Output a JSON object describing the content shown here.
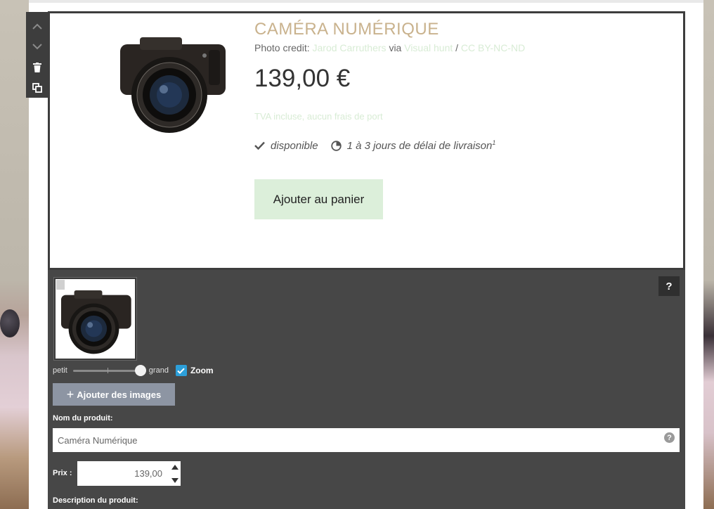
{
  "product": {
    "title": "CAMÉRA NUMÉRIQUE",
    "credit_prefix": "Photo credit:",
    "credit_author": "Jarod Carruthers",
    "credit_via": "via",
    "credit_source": "Visual hunt",
    "credit_sep": "/",
    "credit_license": "CC BY-NC-ND",
    "price": "139,00 €",
    "tax_note": "TVA incluse, aucun frais de port",
    "availability": "disponible",
    "delivery": "1 à 3 jours de délai de livraison",
    "delivery_footnote": "1",
    "add_to_cart": "Ajouter au panier"
  },
  "editor": {
    "help_label": "?",
    "size_small": "petit",
    "size_large": "grand",
    "size_value": 1.0,
    "zoom_label": "Zoom",
    "zoom_checked": true,
    "add_images_label": "Ajouter des images",
    "name_label": "Nom du produit:",
    "name_value": "Caméra Numérique",
    "price_label": "Prix :",
    "price_value": "139,00",
    "description_label": "Description du produit:"
  },
  "icons": {
    "up": "chevron-up-icon",
    "down": "chevron-down-icon",
    "delete": "trash-icon",
    "duplicate": "copy-icon",
    "available": "check-icon",
    "delivery": "clock-icon",
    "add": "plus-icon"
  },
  "colors": {
    "title": "#c9b28d",
    "link": "#d8ecd5",
    "cart_button": "#dcefda",
    "editor_bg": "#474747",
    "checkbox": "#2c9fd9"
  }
}
